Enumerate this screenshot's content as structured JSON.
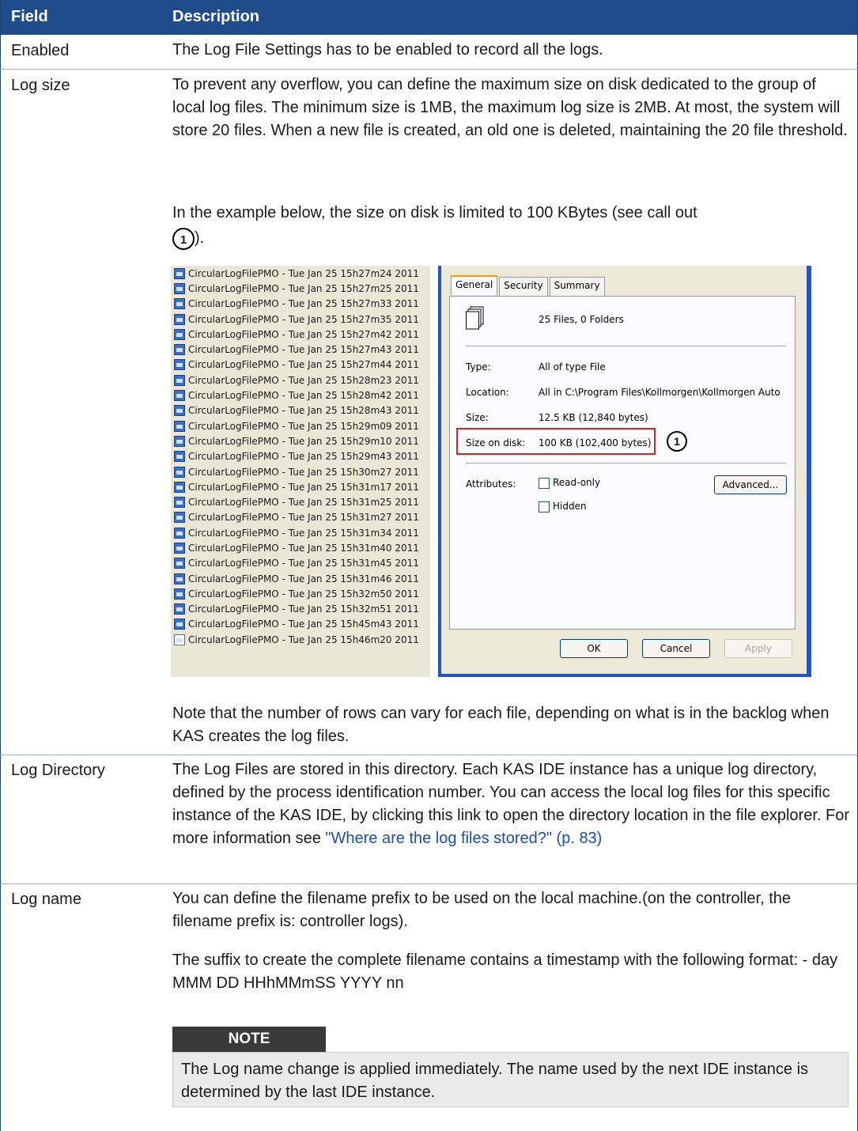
{
  "header": {
    "field": "Field",
    "description": "Description"
  },
  "rows": {
    "enabled": {
      "field": "Enabled",
      "desc": "The Log File Settings has to be enabled to record all the logs."
    },
    "log_size": {
      "field": "Log size",
      "p1": "To prevent any overflow, you can define the maximum size on disk dedicated to the group of local log files. The minimum size is 1MB, the maximum log size is 2MB. At most, the system will store 20 files. When a new file is created, an old one is deleted, maintaining the 20 file threshold.",
      "p2": "In the example below, the size on disk is limited to 100 KBytes (see call out",
      "p2_tail": ").",
      "callout": "1",
      "p3": "Note that the number of rows can vary for each file, depending on what is in the backlog when KAS creates the log files."
    },
    "log_directory": {
      "field": "Log Directory",
      "desc": "The Log Files are stored in this directory. Each KAS IDE instance has a unique log directory, defined by the process identification number. You can access the local log files for this specific instance of the KAS IDE, by clicking this link to open the directory location in the file explorer. For more information see ",
      "link": "\"Where are the log files stored?\" (p. 83)"
    },
    "log_name": {
      "field": "Log name",
      "p1": "You can define the filename prefix to be used on the local machine.(on the controller, the filename prefix is: controller logs).",
      "p2": "The suffix to create the complete filename contains a timestamp with the following format: - day MMM DD HHhMMmSS YYYY nn",
      "note_title": "NOTE",
      "note_text": "The Log name change is applied immediately. The name used by the next IDE instance is determined by the last IDE instance."
    }
  },
  "screenshot": {
    "files": [
      "CircularLogFilePMO - Tue Jan 25 15h27m24 2011",
      "CircularLogFilePMO - Tue Jan 25 15h27m25 2011",
      "CircularLogFilePMO - Tue Jan 25 15h27m33 2011",
      "CircularLogFilePMO - Tue Jan 25 15h27m35 2011",
      "CircularLogFilePMO - Tue Jan 25 15h27m42 2011",
      "CircularLogFilePMO - Tue Jan 25 15h27m43 2011",
      "CircularLogFilePMO - Tue Jan 25 15h27m44 2011",
      "CircularLogFilePMO - Tue Jan 25 15h28m23 2011",
      "CircularLogFilePMO - Tue Jan 25 15h28m42 2011",
      "CircularLogFilePMO - Tue Jan 25 15h28m43 2011",
      "CircularLogFilePMO - Tue Jan 25 15h29m09 2011",
      "CircularLogFilePMO - Tue Jan 25 15h29m10 2011",
      "CircularLogFilePMO - Tue Jan 25 15h29m43 2011",
      "CircularLogFilePMO - Tue Jan 25 15h30m27 2011",
      "CircularLogFilePMO - Tue Jan 25 15h31m17 2011",
      "CircularLogFilePMO - Tue Jan 25 15h31m25 2011",
      "CircularLogFilePMO - Tue Jan 25 15h31m27 2011",
      "CircularLogFilePMO - Tue Jan 25 15h31m34 2011",
      "CircularLogFilePMO - Tue Jan 25 15h31m40 2011",
      "CircularLogFilePMO - Tue Jan 25 15h31m45 2011",
      "CircularLogFilePMO - Tue Jan 25 15h31m46 2011",
      "CircularLogFilePMO - Tue Jan 25 15h32m50 2011",
      "CircularLogFilePMO - Tue Jan 25 15h32m51 2011",
      "CircularLogFilePMO - Tue Jan 25 15h45m43 2011",
      "CircularLogFilePMO - Tue Jan 25 15h46m20 2011"
    ],
    "tabs": [
      "General",
      "Security",
      "Summary"
    ],
    "summary": "25 Files, 0 Folders",
    "type_label": "Type:",
    "type_value": "All of type File",
    "location_label": "Location:",
    "location_value": "All in C:\\Program Files\\Kollmorgen\\Kollmorgen Auto",
    "size_label": "Size:",
    "size_value": "12.5 KB (12,840 bytes)",
    "size_on_disk_label": "Size on disk:",
    "size_on_disk_value": "100 KB (102,400 bytes)",
    "attributes_label": "Attributes:",
    "readonly_label": "Read-only",
    "hidden_label": "Hidden",
    "advanced_button": "Advanced...",
    "ok_button": "OK",
    "cancel_button": "Cancel",
    "apply_button": "Apply",
    "callout": "1"
  }
}
